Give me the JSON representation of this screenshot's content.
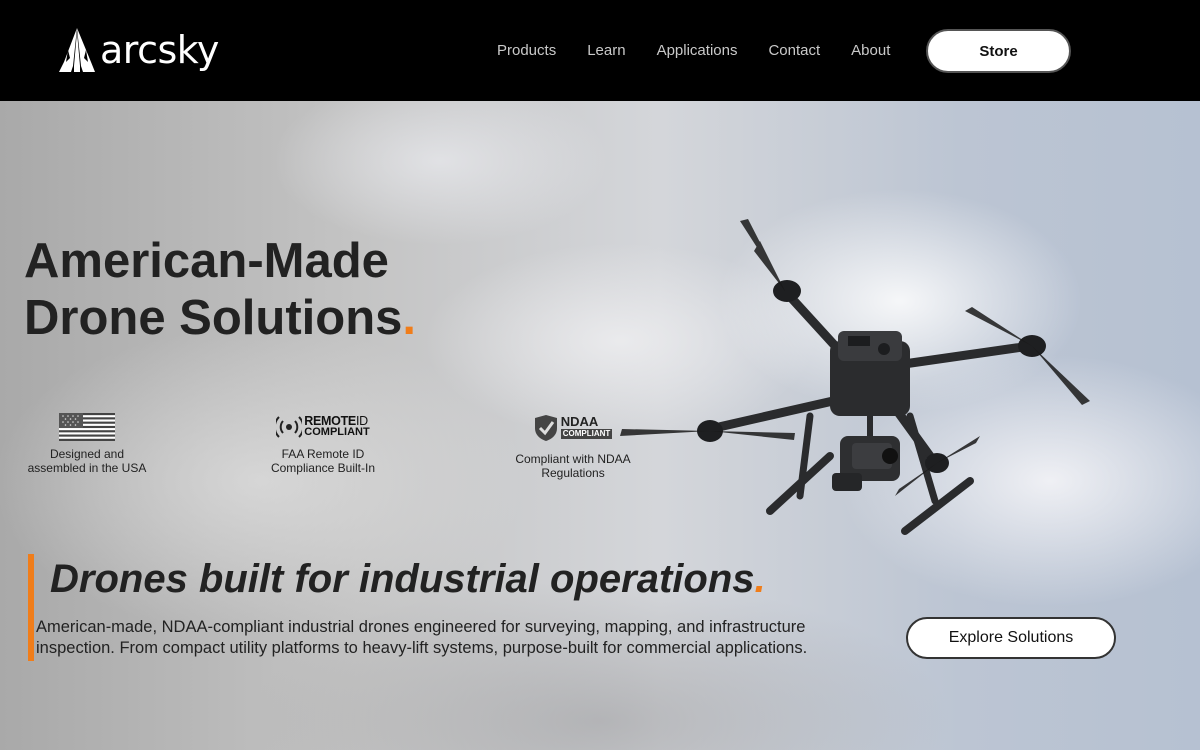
{
  "header": {
    "logo_text": "arcsky",
    "nav": [
      {
        "label": "Products"
      },
      {
        "label": "Learn"
      },
      {
        "label": "Applications"
      },
      {
        "label": "Contact"
      },
      {
        "label": "About"
      }
    ],
    "store_label": "Store"
  },
  "hero": {
    "title_line1": "American-Made",
    "title_line2": "Drone Solutions",
    "title_dot": ".",
    "badges": [
      {
        "icon": "us-flag-icon",
        "caption_line1": "Designed and",
        "caption_line2": "assembled in the USA"
      },
      {
        "icon": "remote-id-icon",
        "logo_line1": "REMOTE",
        "logo_line1_light": "ID",
        "logo_line2": "COMPLIANT",
        "caption_line1": "FAA Remote ID",
        "caption_line2": "Compliance Built-In"
      },
      {
        "icon": "ndaa-shield-icon",
        "logo_line1": "NDAA",
        "logo_line2": "COMPLIANT",
        "caption_line1": "Compliant with NDAA",
        "caption_line2": "Regulations"
      }
    ],
    "subtitle": "Drones built for industrial operations",
    "subtitle_dot": ".",
    "description": "American-made, NDAA-compliant industrial drones engineered for surveying, mapping, and infrastructure inspection. From compact utility platforms to heavy-lift systems, purpose-built for commercial applications.",
    "cta_label": "Explore Solutions"
  },
  "colors": {
    "accent": "#f07d1a",
    "header_bg": "#000000",
    "nav_text": "#c9c9c9"
  }
}
